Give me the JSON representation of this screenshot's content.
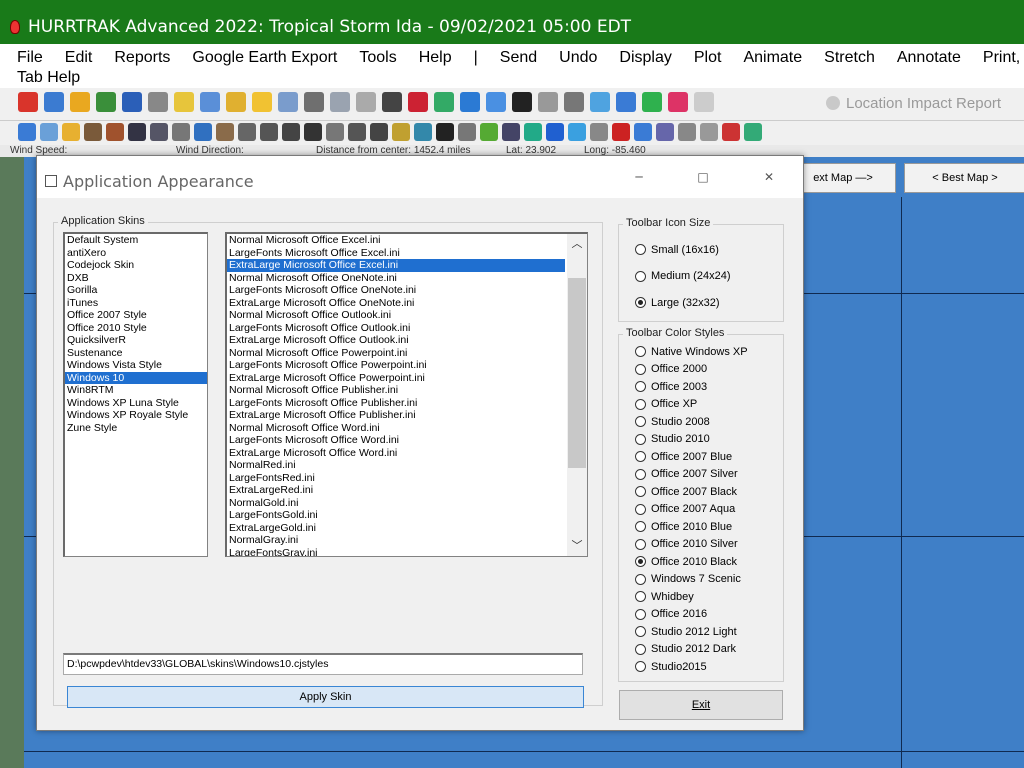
{
  "window": {
    "title": "HURRTRAK Advanced 2022: Tropical Storm Ida - 09/02/2021 05:00 EDT"
  },
  "menu": {
    "row1": [
      "File",
      "Edit",
      "Reports",
      "Google Earth Export",
      "Tools",
      "Help",
      "|",
      "Send",
      "Undo",
      "Display",
      "Plot",
      "Animate",
      "Stretch",
      "Annotate",
      "Print,"
    ],
    "row2": "Tab Help"
  },
  "toolbar": {
    "location_impact_label": "Location Impact Report"
  },
  "status": {
    "wind_speed": "Wind Speed:",
    "wind_direction": "Wind Direction:",
    "distance": "Distance from center: 1452.4 miles",
    "lat": "Lat: 23.902",
    "long": "Long: -85.460"
  },
  "map": {
    "next_map": "ext Map —>",
    "best_map": "< Best Map >"
  },
  "dialog": {
    "title": "Application Appearance",
    "skins_group_label": "Application Skins",
    "skins": [
      "Default System",
      "antiXero",
      "Codejock Skin",
      "DXB",
      "Gorilla",
      "iTunes",
      "Office 2007 Style",
      "Office 2010 Style",
      "QuicksilverR",
      "Sustenance",
      "Windows Vista Style",
      "Windows 10",
      "Win8RTM",
      "Windows XP Luna Style",
      "Windows XP Royale Style",
      "Zune Style"
    ],
    "skins_selected": 11,
    "ini_files": [
      "Normal Microsoft Office Excel.ini",
      "LargeFonts Microsoft Office Excel.ini",
      "ExtraLarge Microsoft Office Excel.ini",
      "Normal Microsoft Office OneNote.ini",
      "LargeFonts Microsoft Office OneNote.ini",
      "ExtraLarge Microsoft Office OneNote.ini",
      "Normal Microsoft Office Outlook.ini",
      "LargeFonts Microsoft Office Outlook.ini",
      "ExtraLarge Microsoft Office Outlook.ini",
      "Normal Microsoft Office Powerpoint.ini",
      "LargeFonts Microsoft Office Powerpoint.ini",
      "ExtraLarge Microsoft Office Powerpoint.ini",
      "Normal Microsoft Office Publisher.ini",
      "LargeFonts Microsoft Office Publisher.ini",
      "ExtraLarge Microsoft Office Publisher.ini",
      "Normal Microsoft Office Word.ini",
      "LargeFonts Microsoft Office Word.ini",
      "ExtraLarge Microsoft Office Word.ini",
      "NormalRed.ini",
      "LargeFontsRed.ini",
      "ExtraLargeRed.ini",
      "NormalGold.ini",
      "LargeFontsGold.ini",
      "ExtraLargeGold.ini",
      "NormalGray.ini",
      "LargeFontsGray.ini"
    ],
    "ini_selected": 2,
    "skin_path": "D:\\pcwpdev\\htdev33\\GLOBAL\\skins\\Windows10.cjstyles",
    "apply_label": "Apply Skin",
    "icon_size_label": "Toolbar Icon Size",
    "icon_sizes": [
      "Small (16x16)",
      "Medium (24x24)",
      "Large (32x32)"
    ],
    "icon_size_selected": 2,
    "color_styles_label": "Toolbar Color Styles",
    "color_styles": [
      "Native Windows XP",
      "Office 2000",
      "Office 2003",
      "Office XP",
      "Studio 2008",
      "Studio 2010",
      "Office 2007 Blue",
      "Office 2007 Silver",
      "Office 2007 Black",
      "Office 2007 Aqua",
      "Office 2010 Blue",
      "Office 2010 Silver",
      "Office 2010 Black",
      "Windows 7 Scenic",
      "Whidbey",
      "Office 2016",
      "Studio 2012 Light",
      "Studio 2012 Dark",
      "Studio2015"
    ],
    "color_style_selected": 12,
    "exit_label": "Exit"
  },
  "colors": {
    "titlebar": "#197a19",
    "selection": "#1f6fd0",
    "map_ocean": "#3f7fc7"
  }
}
